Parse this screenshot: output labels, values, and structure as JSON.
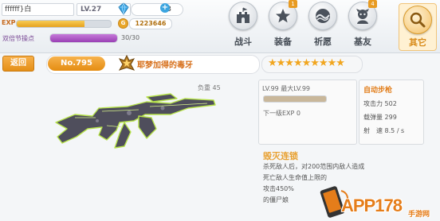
{
  "player": {
    "name": "ffffff}白",
    "level": "LV.27",
    "gems": "3",
    "exp_label": "EXP",
    "exp_progress": 0.72,
    "gold": "1223646",
    "double_xp_label": "双倍节操点",
    "double_xp_value": "30/30",
    "double_xp_progress": 1.0
  },
  "nav": [
    {
      "label": "战斗",
      "icon": "castle-icon",
      "badge": ""
    },
    {
      "label": "装备",
      "icon": "star-icon",
      "badge": "1"
    },
    {
      "label": "祈愿",
      "icon": "wave-icon",
      "badge": ""
    },
    {
      "label": "基友",
      "icon": "friends-icon",
      "badge": "4"
    },
    {
      "label": "其它",
      "icon": "more-icon",
      "badge": "",
      "active": true
    }
  ],
  "header": {
    "back_label": "返回",
    "number": "No.795",
    "weapon_name": "耶梦加得的毒牙",
    "stars": "★★★★★★★★★",
    "star_count": 9
  },
  "weapon": {
    "load_label": "负重 45",
    "level_line": "LV.99 最大LV.99",
    "level_progress": 1.0,
    "next_exp": "下一级EXP 0",
    "type": "自动步枪",
    "stats": [
      {
        "label": "攻击力",
        "value": "502"
      },
      {
        "label": "载弹量",
        "value": "299"
      },
      {
        "label": "射　速",
        "value": "8.5 / s"
      }
    ]
  },
  "skill": {
    "title": "毁灭连锁",
    "lines": [
      "杀死敌人后，对200范围内敌人造成",
      "死亡敌人生命值上限的",
      "攻击450%",
      "的僵尸娘"
    ]
  },
  "watermark": {
    "text": "APP178",
    "sub": "手游网"
  },
  "colors": {
    "accent": "#e58f17",
    "star": "#f1a61f",
    "gun_glow": "#b6e24a"
  }
}
